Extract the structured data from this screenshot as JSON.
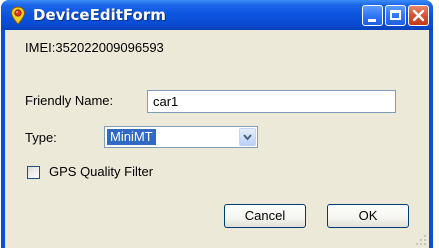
{
  "window": {
    "title": "DeviceEditForm",
    "icons": {
      "app": "location-pin-icon",
      "minimize": "minimize-icon",
      "maximize": "maximize-icon",
      "close": "close-icon"
    },
    "colors": {
      "titlebar": "#0b54df",
      "close_button": "#d5522f",
      "client_background": "#ece9d8"
    }
  },
  "form": {
    "imei_text": "IMEI:352022009096593",
    "friendly_name_label": "Friendly Name:",
    "friendly_name_value": "car1",
    "type_label": "Type:",
    "type_selected": "MiniMT",
    "gps_quality_filter_label": "GPS Quality Filter",
    "gps_quality_filter_checked": false
  },
  "buttons": {
    "cancel": "Cancel",
    "ok": "OK"
  }
}
